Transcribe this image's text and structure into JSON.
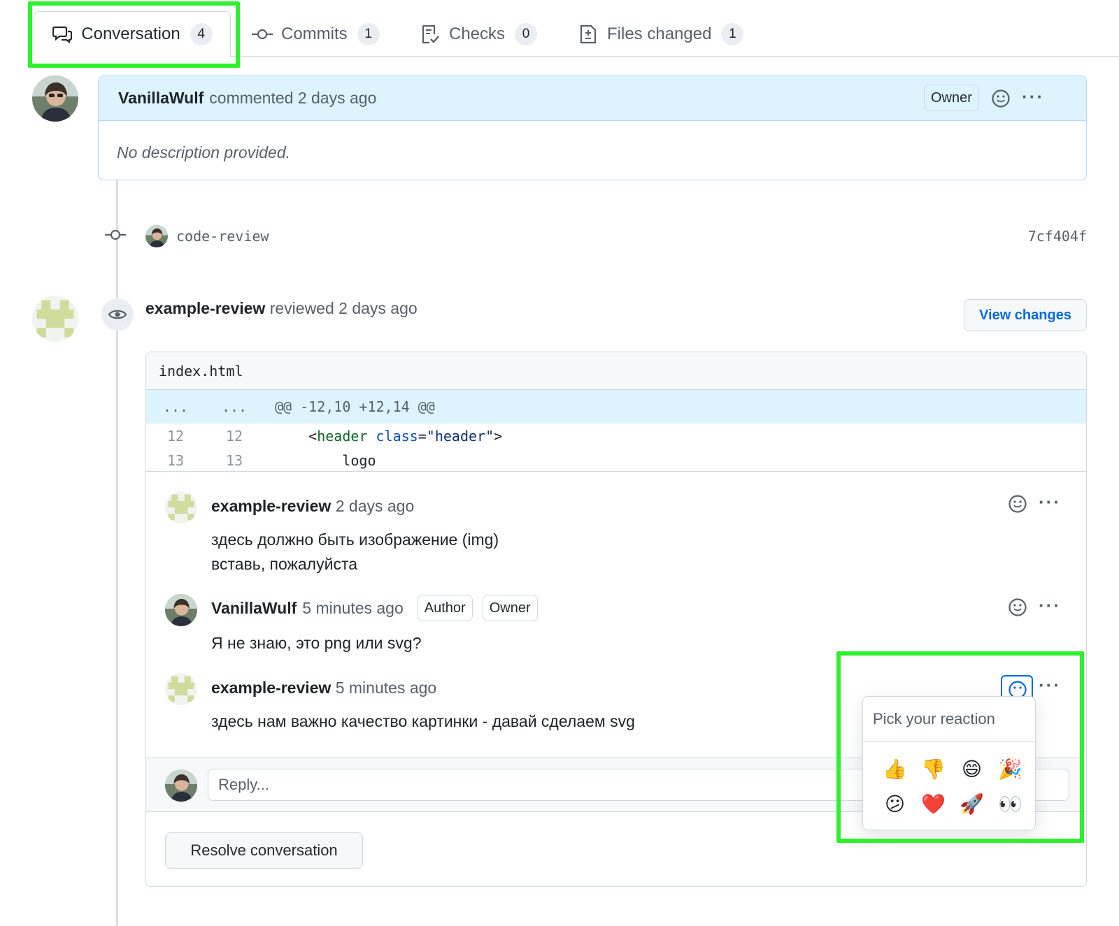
{
  "tabs": [
    {
      "label": "Conversation",
      "count": "4",
      "icon": "comment-discussion-icon"
    },
    {
      "label": "Commits",
      "count": "1",
      "icon": "git-commit-icon"
    },
    {
      "label": "Checks",
      "count": "0",
      "icon": "checklist-icon"
    },
    {
      "label": "Files changed",
      "count": "1",
      "icon": "file-diff-icon"
    }
  ],
  "first_comment": {
    "author": "VanillaWulf",
    "action": "commented 2 days ago",
    "badge": "Owner",
    "body": "No description provided."
  },
  "commit": {
    "message": "code-review",
    "sha": "7cf404f"
  },
  "review": {
    "author": "example-review",
    "action": "reviewed 2 days ago",
    "view_changes_label": "View changes",
    "file_name": "index.html",
    "hunk": {
      "left": "...",
      "right": "...",
      "header": "@@ -12,10 +12,14 @@"
    },
    "lines": [
      {
        "old": "12",
        "new": "12",
        "indent": "    ",
        "tag_open": "<",
        "tag": "header",
        "attr": "class",
        "value": "\"header\"",
        "close": ">"
      },
      {
        "old": "13",
        "new": "13",
        "code": "        logo"
      }
    ],
    "thread": [
      {
        "author": "example-review",
        "time": "2 days ago",
        "lines": [
          "здесь должно быть изображение (img)",
          "вставь, пожалуйста"
        ]
      },
      {
        "author": "VanillaWulf",
        "time": "5 minutes ago",
        "badges": [
          "Author",
          "Owner"
        ],
        "lines": [
          "Я не знаю, это png или svg?"
        ]
      },
      {
        "author": "example-review",
        "time": "5 minutes ago",
        "lines": [
          "здесь нам важно качество картинки - давай сделаем svg"
        ]
      }
    ],
    "reply_placeholder": "Reply...",
    "resolve_label": "Resolve conversation"
  },
  "reaction_picker": {
    "title": "Pick your reaction",
    "emojis": [
      "👍",
      "👎",
      "😄",
      "🎉",
      "😕",
      "❤️",
      "🚀",
      "👀"
    ],
    "emoji_names": [
      "thumbs-up",
      "thumbs-down",
      "laugh",
      "hooray",
      "confused",
      "heart",
      "rocket",
      "eyes"
    ]
  },
  "colors": {
    "highlight": "#2ef02e",
    "link": "#0969da",
    "header_bg": "#ddf4ff"
  }
}
